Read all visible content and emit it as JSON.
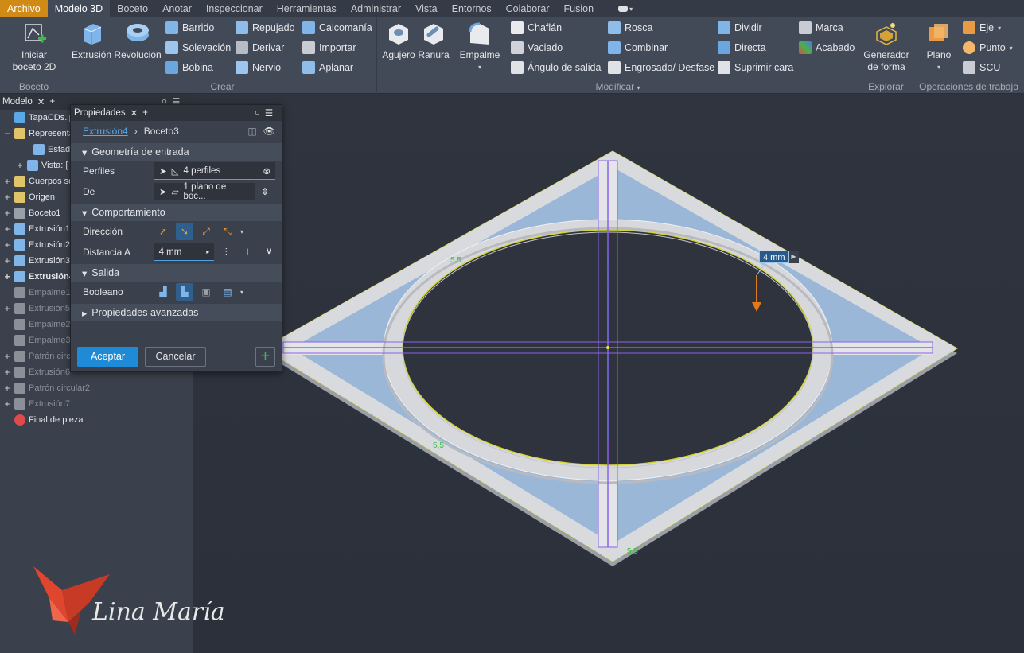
{
  "menu": {
    "file": "Archivo",
    "tabs": [
      "Modelo 3D",
      "Boceto",
      "Anotar",
      "Inspeccionar",
      "Herramientas",
      "Administrar",
      "Vista",
      "Entornos",
      "Colaborar",
      "Fusion"
    ]
  },
  "ribbon": {
    "sketch_panel": {
      "title": "Boceto",
      "start_sketch": "Iniciar boceto 2D"
    },
    "create_panel": {
      "title": "Crear",
      "extrusion": "Extrusión",
      "revolution": "Revolución",
      "sweep": "Barrido",
      "loft": "Solevación",
      "coil": "Bobina",
      "emboss": "Repujado",
      "derive": "Derivar",
      "rib": "Nervio",
      "decal": "Calcomanía",
      "import": "Importar",
      "unwrap": "Aplanar"
    },
    "modify_panel": {
      "title": "Modificar",
      "hole": "Agujero",
      "slot": "Ranura",
      "fillet": "Empalme",
      "chamfer": "Chaflán",
      "shell": "Vaciado",
      "draft": "Ángulo de salida",
      "thread": "Rosca",
      "combine": "Combinar",
      "thicken": "Engrosado/ Desfase",
      "split": "Dividir",
      "direct": "Directa",
      "delete_face": "Suprimir cara",
      "mark": "Marca",
      "finish": "Acabado"
    },
    "explore_panel": {
      "title": "Explorar",
      "shape_generator": "Generador de forma"
    },
    "work_panel": {
      "title": "Operaciones de trabajo",
      "plane": "Plano",
      "axis": "Eje",
      "point": "Punto",
      "ucs": "SCU"
    }
  },
  "browser": {
    "tab": "Modelo",
    "items": [
      {
        "label": "TapaCDs.ipt",
        "state": "normal"
      },
      {
        "label": "Representa",
        "state": "normal"
      },
      {
        "label": "Estado",
        "state": "normal"
      },
      {
        "label": "Vista: [",
        "state": "normal"
      },
      {
        "label": "Cuerpos só",
        "state": "normal"
      },
      {
        "label": "Origen",
        "state": "normal"
      },
      {
        "label": "Boceto1",
        "state": "normal"
      },
      {
        "label": "Extrusión1",
        "state": "normal"
      },
      {
        "label": "Extrusión2",
        "state": "normal"
      },
      {
        "label": "Extrusión3",
        "state": "normal"
      },
      {
        "label": "Extrusión4",
        "state": "bold"
      },
      {
        "label": "Empalme1",
        "state": "dim"
      },
      {
        "label": "Extrusión5",
        "state": "dim"
      },
      {
        "label": "Empalme2",
        "state": "dim"
      },
      {
        "label": "Empalme3",
        "state": "dim"
      },
      {
        "label": "Patrón circ",
        "state": "dim"
      },
      {
        "label": "Extrusión6",
        "state": "dim"
      },
      {
        "label": "Patrón circular2",
        "state": "dim"
      },
      {
        "label": "Extrusión7",
        "state": "dim"
      },
      {
        "label": "Final de pieza",
        "state": "normal"
      }
    ]
  },
  "properties": {
    "tab": "Propiedades",
    "breadcrumb": {
      "feature": "Extrusión4",
      "sketch": "Boceto3"
    },
    "input_section": "Geometría de entrada",
    "profiles_label": "Perfiles",
    "profiles_value": "4 perfiles",
    "from_label": "De",
    "from_value": "1 plano de boc...",
    "behavior_section": "Comportamiento",
    "direction_label": "Dirección",
    "distance_label": "Distancia A",
    "distance_value": "4 mm",
    "output_section": "Salida",
    "boolean_label": "Booleano",
    "advanced_section": "Propiedades avanzadas",
    "accept": "Aceptar",
    "cancel": "Cancelar"
  },
  "viewport": {
    "dimension_tag": "4 mm",
    "dim_a": "5,5",
    "dim_b": "5,5",
    "dim_c": "5,5"
  },
  "watermark": {
    "text": "Lina María"
  }
}
